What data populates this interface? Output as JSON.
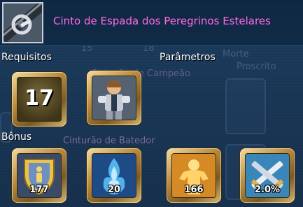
{
  "item": {
    "title": "Cinto de Espada dos Peregrinos Estelares",
    "icon": "sword-belt-icon"
  },
  "sections": {
    "requirements_label": "Requisitos",
    "parameters_label": "Parâmetros",
    "bonus_label": "Bônus"
  },
  "requirements": {
    "level": "17"
  },
  "parameters": {
    "icon": "knight-character-icon"
  },
  "bonuses": [
    {
      "icon": "shield-figure-icon",
      "value": "177"
    },
    {
      "icon": "blue-flame-icon",
      "value": "20"
    },
    {
      "icon": "golden-body-icon",
      "value": "166"
    },
    {
      "icon": "crossed-swords-icon",
      "value": "2.0%"
    }
  ],
  "background_text": {
    "t1": "15",
    "t2": "18",
    "t3": "Cavaleiro da Morte",
    "t4": "Proscrito",
    "t5": "Cinturão de Campeão",
    "t6": "Cinturão de Batedor"
  }
}
